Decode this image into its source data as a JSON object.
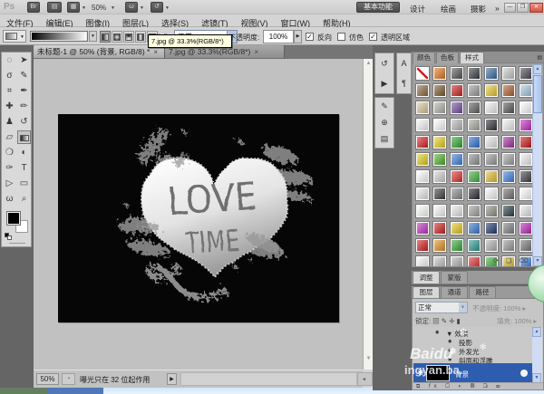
{
  "titlebar": {
    "logo": "Ps",
    "zoom_level": "50%",
    "workspaces": [
      "基本功能",
      "设计",
      "绘画",
      "摄影"
    ],
    "overflow": "»",
    "minimize": "—",
    "restore": "❐",
    "close": "✕"
  },
  "menubar": {
    "items": [
      "文件(F)",
      "编辑(E)",
      "图像(I)",
      "图层(L)",
      "选择(S)",
      "滤镜(T)",
      "视图(V)",
      "窗口(W)",
      "帮助(H)"
    ]
  },
  "optionsbar": {
    "mode_label": "模式:",
    "mode_value": "正常",
    "opacity_label": "不透明度:",
    "opacity_value": "100%",
    "checkboxes": [
      {
        "label": "反向",
        "checked": true
      },
      {
        "label": "仿色",
        "checked": false
      },
      {
        "label": "透明区域",
        "checked": true
      }
    ]
  },
  "tooltip": {
    "text": "7.jpg @ 33.3%(RGB/8*)"
  },
  "tabs": [
    {
      "label": "未标题-1 @ 50% (背景, RGB/8) *",
      "close": "×",
      "active": true
    },
    {
      "label": "7.jpg @ 33.3%(RGB/8*)",
      "close": "×",
      "active": false
    }
  ],
  "toolbar": {
    "tools": [
      "rectangular-marquee",
      "move",
      "lasso",
      "quick-selection",
      "crop",
      "eyedropper",
      "healing-brush",
      "brush",
      "clone-stamp",
      "history-brush",
      "eraser",
      "gradient",
      "blur",
      "dodge",
      "pen",
      "type",
      "path-selection",
      "shape",
      "hand",
      "zoom"
    ],
    "glyphs": [
      "◌",
      "➤",
      "σ",
      "✎",
      "⌗",
      "✒",
      "✚",
      "✏",
      "♟",
      "↺",
      "▱",
      "",
      "❍",
      "◐",
      "✑",
      "T",
      "▷",
      "▭",
      "ω",
      "⌕"
    ],
    "selected": "gradient"
  },
  "canvas": {
    "text_line1": "LOVE",
    "text_line2": "TIME",
    "background": "#060606"
  },
  "statusbar": {
    "zoom": "50%",
    "icon": "◔",
    "message": "曝光只在 32 位起作用",
    "play": "▶"
  },
  "dock_icons": {
    "col1_group1": [
      {
        "name": "history-panel",
        "glyph": "↺"
      },
      {
        "name": "actions-panel",
        "glyph": "▶"
      }
    ],
    "col1_group2": [
      {
        "name": "brushes-panel",
        "glyph": "✎"
      },
      {
        "name": "clone-source-panel",
        "glyph": "⊕"
      },
      {
        "name": "layer-comps-panel",
        "glyph": "▤"
      }
    ],
    "col2": [
      {
        "name": "character-panel",
        "glyph": "A"
      },
      {
        "name": "paragraph-panel",
        "glyph": "¶"
      }
    ]
  },
  "styles_panel": {
    "tabs": [
      "颜色",
      "色板",
      "样式"
    ],
    "active_tab": "样式",
    "swatches": [
      "none",
      "#e07820",
      "#555555",
      "#3a3f44",
      "#3d6aa0",
      "#c8c8c8",
      "#4a4a52",
      "#8a6a40",
      "#7a5a30",
      "#cc2222",
      "#9a9a9a",
      "#e8c830",
      "#b06030",
      "#a8c8e0",
      "#d8c8a0",
      "#b0b0a8",
      "#7050a0",
      "#606060",
      "#f0f0f0",
      "#585858",
      "#ffffff",
      "#f8f8f8",
      "#ffffff",
      "#b8b8b8",
      "#a8a8a0",
      "#303038",
      "#f0f0f0",
      "#c030c0",
      "#d82020",
      "#e8d020",
      "#30a830",
      "#3070d0",
      "#e8e8e8",
      "#a030a0",
      "#cc1818",
      "#e0d020",
      "#50b030",
      "#4080d8",
      "#909090",
      "#989898",
      "#a0a0a0",
      "#f0f0f0",
      "#ffffff",
      "#d0d0d0",
      "#e03030",
      "#40b040",
      "#e0c030",
      "#4080e0",
      "#404048",
      "#e8e8e8",
      "#404040",
      "#888888",
      "#282830",
      "#f8f8f8",
      "#707070",
      "#ffffff",
      "#ffffff",
      "#f8f8f8",
      "#e8e8e8",
      "#a0a0a0",
      "#909088",
      "#284048",
      "#e8e8e8",
      "#c030c0",
      "#d02020",
      "#e8c820",
      "#3878d0",
      "#203870",
      "#808080",
      "#b828b8",
      "#d02020",
      "#e09020",
      "#38a838",
      "#309890",
      "#b0b0b0",
      "#989898",
      "#787878",
      "#f8f8f8",
      "#c0c0c0",
      "#b0b0b0",
      "#e03030",
      "#40b040",
      "#e0c030",
      "#4080e0"
    ],
    "footer_icons": "⟳ ❏ ⌫"
  },
  "adjust_panel": {
    "tabs": [
      "调整",
      "蒙版"
    ],
    "active_tab": "调整"
  },
  "layers_panel": {
    "tabs": [
      "图层",
      "通道",
      "路径"
    ],
    "active_tab": "图层",
    "blend_mode": "正常",
    "opacity_label": "不透明度:",
    "opacity_value": "100%",
    "lock_label": "锁定:",
    "lock_icons": "▨ ✎ ✛ ▮",
    "fill_label": "填充:",
    "fill_value": "100%",
    "effect_rows": [
      {
        "label": "效果",
        "indent": 24,
        "expander": "▼"
      },
      {
        "label": "投影",
        "indent": 38,
        "expander": ""
      },
      {
        "label": "外发光",
        "indent": 38,
        "expander": ""
      },
      {
        "label": "斜面和浮雕",
        "indent": 38,
        "expander": ""
      }
    ],
    "selected_layer": {
      "label": "背景",
      "eye": "◉"
    },
    "bottom_icons": "⧉ fx ▢ ◐ ▤ ❏ ⌦"
  },
  "watermark": {
    "line1": "Baidu",
    "line2": "ingyan.ba.",
    "flakes": [
      "❄",
      "✻",
      "✽"
    ]
  },
  "colors": {
    "chrome": "#d4d4d4",
    "tabbar_bg": "#757575",
    "dock_bg": "#6e6e6e",
    "doc_area": "#c1c1c1",
    "selected_layer_blue": "#2e5daf",
    "taskbar_green": "#647e60",
    "taskbar_blue": "#5077b8",
    "taskbar_light": "#d5e9ff"
  }
}
